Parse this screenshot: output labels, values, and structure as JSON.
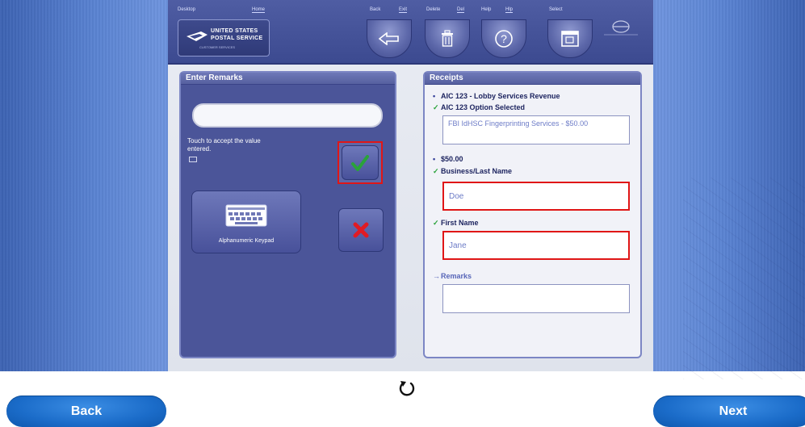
{
  "header": {
    "top_labels": [
      "Desktop",
      "Home",
      "Back",
      "Exit",
      "Delete",
      "Del",
      "Help",
      "Hlp",
      "Select"
    ],
    "logo": {
      "line1": "UNITED STATES",
      "line2": "POSTAL SERVICE",
      "line3": "CUSTOMER SERVICES"
    },
    "icons": [
      "back-arrow-icon",
      "trash-icon",
      "help-icon",
      "window-icon",
      "menu-arrow-icon"
    ]
  },
  "remarks_panel": {
    "title": "Enter Remarks",
    "input_value": "",
    "touch_text": "Touch to accept the value entered.",
    "keypad_label": "Alphanumeric Keypad"
  },
  "receipts_panel": {
    "title": "Receipts",
    "lines": [
      {
        "text": "AIC 123 - Lobby Services Revenue"
      },
      {
        "text": "AIC 123 Option Selected"
      }
    ],
    "option_box": "FBI IdHSC Fingerprinting Services - $50.00",
    "amount": "$50.00",
    "business_label": "Business/Last Name",
    "business_value": "Doe",
    "first_label": "First Name",
    "first_value": "Jane",
    "remarks_label": "Remarks",
    "remarks_value": ""
  },
  "footer": {
    "back_label": "Back",
    "next_label": "Next"
  },
  "colors": {
    "highlight_red": "#e01616",
    "check_green": "#2aa33a",
    "x_red": "#e01b24",
    "button_blue": "#1b6cc9"
  }
}
